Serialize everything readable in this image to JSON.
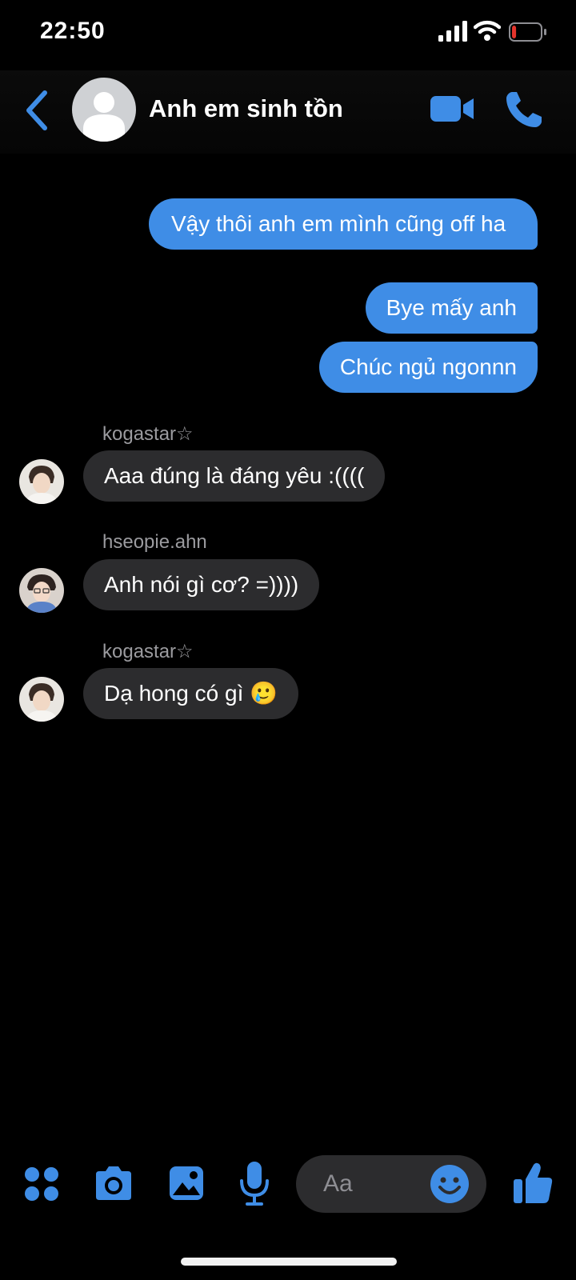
{
  "status_bar": {
    "time": "22:50",
    "battery_level": 0.15
  },
  "header": {
    "title": "Anh em sinh tồn",
    "accent": "#3f8de6"
  },
  "messages_out": [
    {
      "text": "Vậy thôi anh em mình cũng off ha"
    },
    {
      "text": "Bye mấy anh"
    },
    {
      "text": "Chúc ngủ ngonnn"
    }
  ],
  "messages_in": [
    {
      "sender": "kogastar☆",
      "text": "Aaa đúng là đáng yêu :(((("
    },
    {
      "sender": "hseopie.ahn",
      "text": "Anh nói gì cơ? =))))"
    },
    {
      "sender": "kogastar☆",
      "text": "Dạ hong có gì",
      "emoji": "🥲"
    }
  ],
  "composer": {
    "placeholder": "Aa",
    "icons": [
      "apps-icon",
      "camera-icon",
      "image-icon",
      "microphone-icon",
      "emoji-icon",
      "thumbs-up-icon"
    ]
  },
  "colors": {
    "outgoing_bubble": "#3f8de6",
    "incoming_bubble": "#2c2c2e",
    "background": "#000000",
    "battery_low": "#e5342c"
  }
}
